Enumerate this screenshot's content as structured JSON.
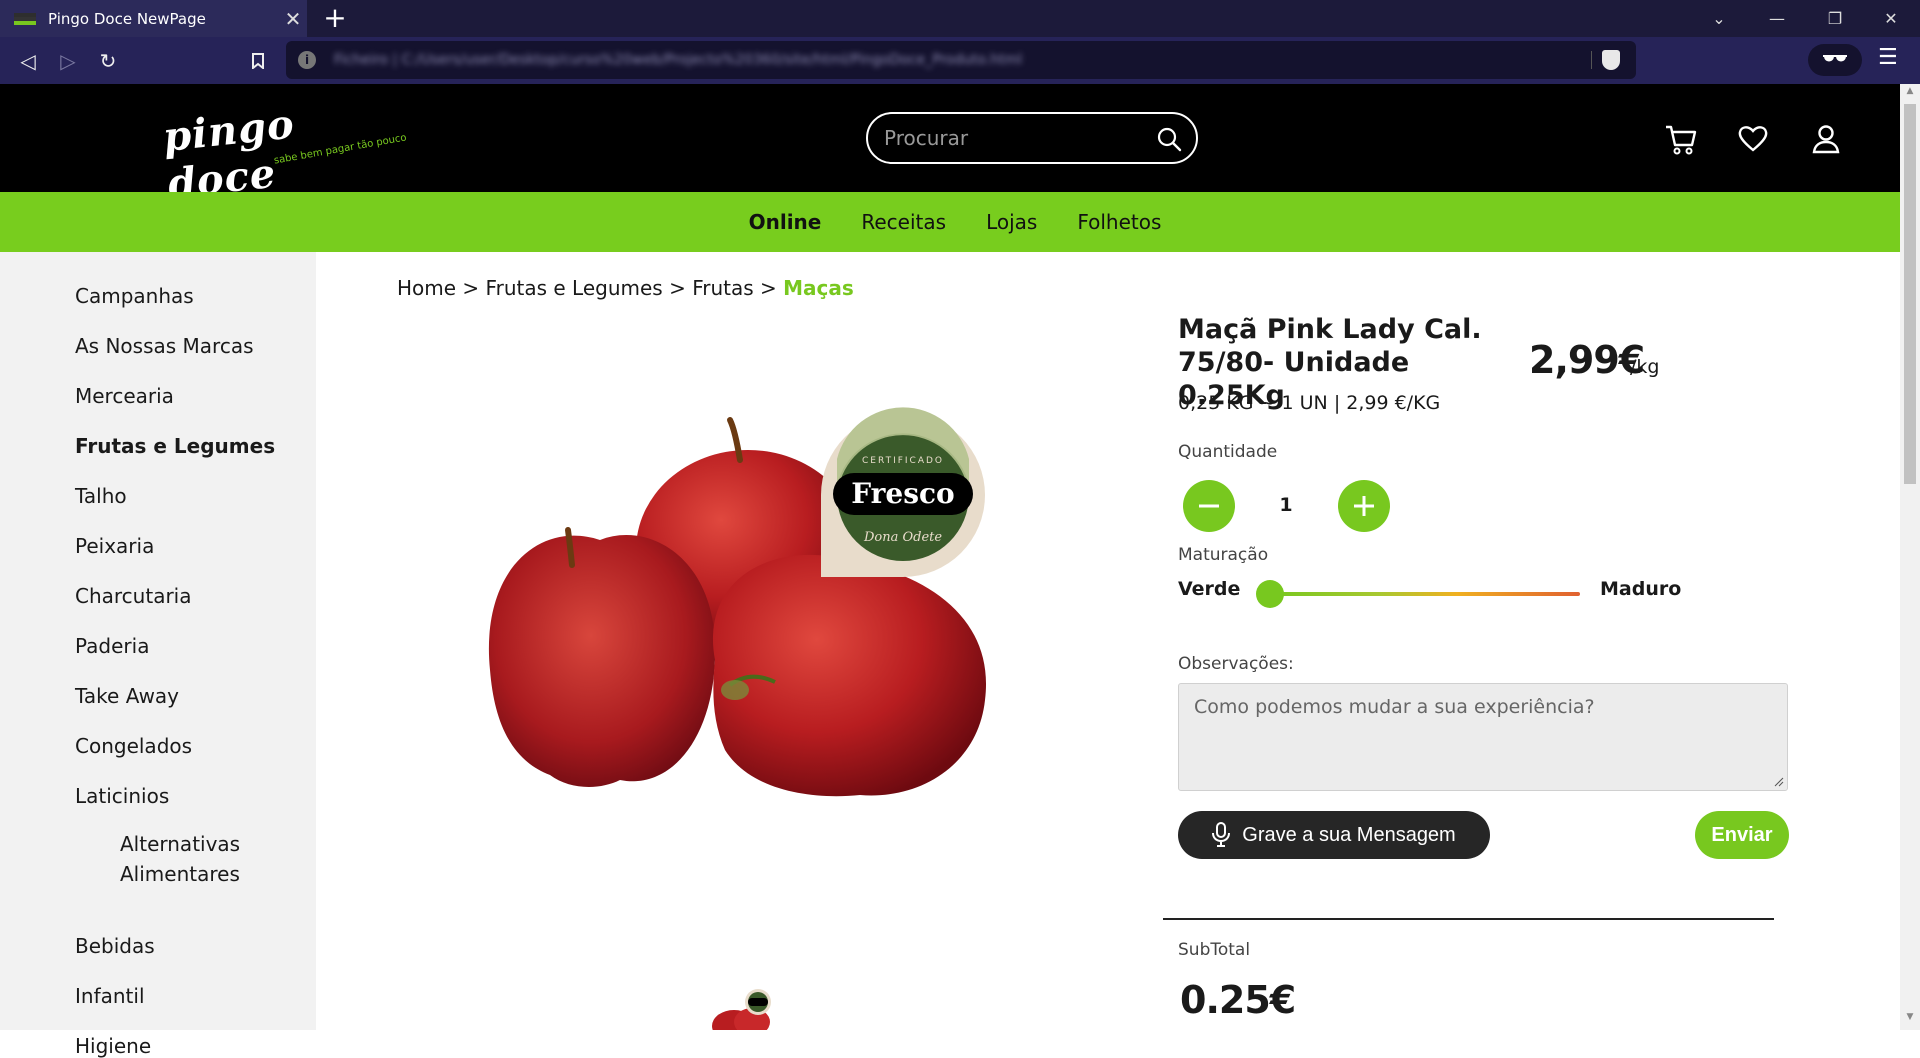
{
  "browser": {
    "tab_title": "Pingo Doce NewPage",
    "tab_close": "✕",
    "new_tab": "+",
    "url": "Ficheiro | C:/Users/user/Desktop/curso%20web/Projecto%20360/site/html/PingoDoce_Produto.html"
  },
  "header": {
    "logo_text": "pingo doce",
    "logo_tagline": "sabe bem pagar tão pouco",
    "search_placeholder": "Procurar"
  },
  "nav": {
    "items": [
      "Online",
      "Receitas",
      "Lojas",
      "Folhetos"
    ]
  },
  "sidebar": {
    "items": [
      "Campanhas",
      "As Nossas Marcas",
      "Mercearia",
      "Frutas e Legumes",
      "Talho",
      "Peixaria",
      "Charcutaria",
      "Paderia",
      "Take Away",
      "Congelados",
      "Laticinios"
    ],
    "sub_item_line1": "Alternativas",
    "sub_item_line2": "Alimentares",
    "items_after": [
      "Bebidas",
      "Infantil",
      "Higiene"
    ]
  },
  "breadcrumb": {
    "home": "Home",
    "sep": ">",
    "level1": "Frutas e Legumes",
    "level2": "Frutas",
    "current": "Maças"
  },
  "badge": {
    "top": "CERTIFICADO",
    "main": "Fresco",
    "bottom": "Dona Odete"
  },
  "product": {
    "title": "Maçã Pink Lady Cal. 75/80- Unidade 0.25Kg",
    "price": "2,99€",
    "price_unit": "/kg",
    "detail": "0,25 KG ~ 1 UN | 2,99 €/KG",
    "quantity_label": "Quantidade",
    "quantity": "1",
    "maturation_label": "Maturação",
    "maturation_min": "Verde",
    "maturation_max": "Maduro",
    "maturation_level": 0,
    "observations_label": "Observações:",
    "observations_placeholder": "Como podemos mudar a sua experiência?",
    "record_button": "Grave a sua Mensagem",
    "send_button": "Enviar",
    "subtotal_label": "SubTotal",
    "subtotal_value": "0.25€"
  },
  "colors": {
    "brand_green": "#78c81f",
    "header_black": "#000000",
    "browser_purple": "#262358"
  }
}
